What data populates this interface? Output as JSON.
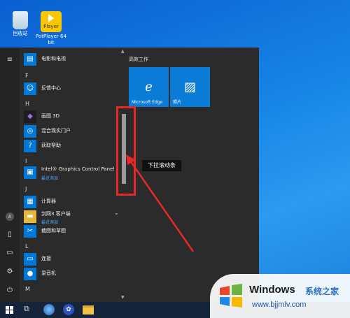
{
  "desktop": {
    "icons": [
      {
        "label": "回收站"
      },
      {
        "label": "PotPlayer 64 bit",
        "logo_text": "Player"
      }
    ]
  },
  "start_menu": {
    "app_list": {
      "sections": [
        {
          "letter": "",
          "apps": [
            {
              "name": "电影和电视",
              "icon": "film-icon"
            }
          ]
        },
        {
          "letter": "F",
          "apps": [
            {
              "name": "反馈中心",
              "icon": "feedback-icon"
            }
          ]
        },
        {
          "letter": "H",
          "apps": [
            {
              "name": "画图 3D",
              "icon": "paint3d-icon"
            },
            {
              "name": "混合现实门户",
              "icon": "mixed-reality-icon"
            },
            {
              "name": "获取帮助",
              "icon": "help-icon"
            }
          ]
        },
        {
          "letter": "I",
          "apps": [
            {
              "name": "Intel® Graphics Control Panel",
              "sub": "最近添加",
              "icon": "intel-icon"
            }
          ]
        },
        {
          "letter": "J",
          "apps": [
            {
              "name": "计算器",
              "icon": "calculator-icon"
            },
            {
              "name": "剑网3 客户端",
              "sub": "最近添加",
              "icon": "folder-icon"
            },
            {
              "name": "截图和草图",
              "icon": "snip-icon"
            }
          ]
        },
        {
          "letter": "L",
          "apps": [
            {
              "name": "连接",
              "icon": "connect-icon"
            },
            {
              "name": "录音机",
              "icon": "recorder-icon"
            }
          ]
        },
        {
          "letter": "M",
          "apps": []
        }
      ]
    },
    "tiles": {
      "group_title": "高效工作",
      "items": [
        {
          "label": "Microsoft Edge",
          "icon": "edge-icon"
        },
        {
          "label": "照片",
          "icon": "photos-icon"
        }
      ]
    },
    "rail": [
      "hamburger-icon",
      "user-icon",
      "documents-icon",
      "pictures-icon",
      "settings-icon",
      "power-icon"
    ]
  },
  "annotation": {
    "text": "下拉滚动条",
    "color": "#e8272b"
  },
  "taskbar": {
    "items": [
      "windows-start-icon",
      "task-view-icon",
      "browser-icon",
      "baidu-icon",
      "file-explorer-icon"
    ]
  },
  "watermark": {
    "brand": "Windows",
    "brand_cn": "系统之家",
    "url": "www.bjjmlv.com"
  }
}
